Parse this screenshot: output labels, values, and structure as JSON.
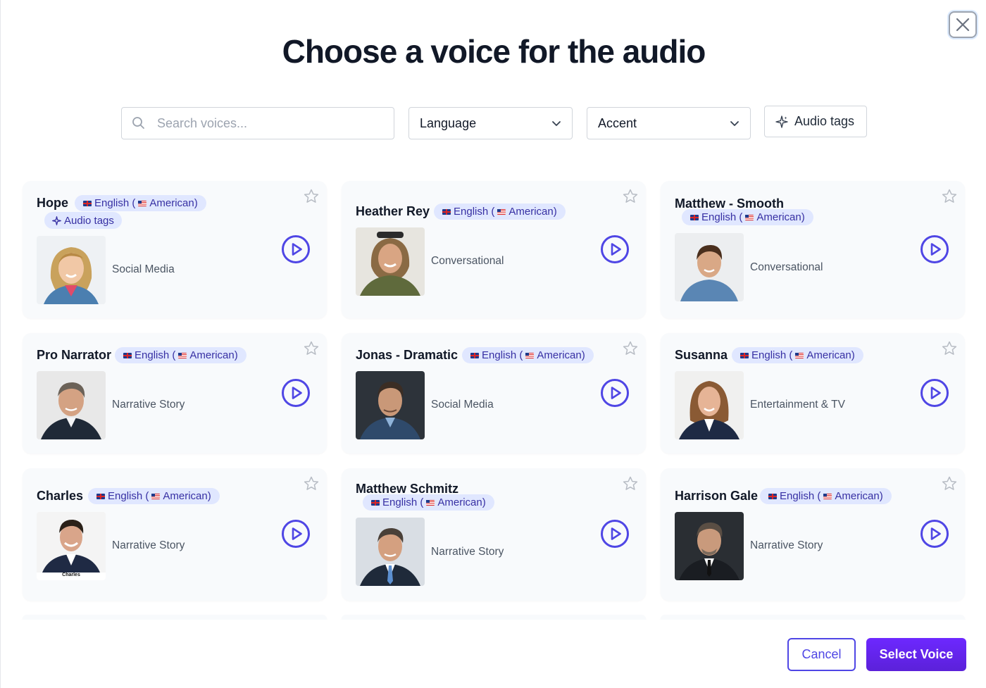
{
  "modal": {
    "title": "Choose a voice for the audio",
    "close_icon": "close-icon"
  },
  "filters": {
    "search_placeholder": "Search voices...",
    "language_label": "Language",
    "accent_label": "Accent",
    "audio_tags_label": "Audio tags"
  },
  "voices": [
    {
      "name": "Hope",
      "badge_left": "English (",
      "badge_right": "American)",
      "audio_tags": "Audio tags",
      "style": "Social Media"
    },
    {
      "name": "Heather Rey",
      "badge_left": "English (",
      "badge_right": "American)",
      "style": "Conversational"
    },
    {
      "name": "Matthew - Smooth",
      "badge_left": "English (",
      "badge_right": "American)",
      "style": "Conversational"
    },
    {
      "name": "Pro Narrator",
      "badge_left": "English (",
      "badge_right": "American)",
      "style": "Narrative Story"
    },
    {
      "name": "Jonas - Dramatic",
      "badge_left": "English (",
      "badge_right": "American)",
      "style": "Social Media"
    },
    {
      "name": "Susanna",
      "badge_left": "English (",
      "badge_right": "American)",
      "style": "Entertainment & TV"
    },
    {
      "name": "Charles",
      "badge_left": "English (",
      "badge_right": "American)",
      "style": "Narrative Story",
      "avatar_caption": "Charles"
    },
    {
      "name": "Matthew Schmitz",
      "badge_left": "English (",
      "badge_right": "American)",
      "style": "Narrative Story"
    },
    {
      "name": "Harrison Gale",
      "badge_left": "English (",
      "badge_right": "American)",
      "style": "Narrative Story"
    }
  ],
  "footer": {
    "cancel_label": "Cancel",
    "select_label": "Select Voice"
  },
  "colors": {
    "accent": "#5b21f6",
    "badge_bg": "#e0e7ff",
    "play_icon": "#4f46e5"
  }
}
